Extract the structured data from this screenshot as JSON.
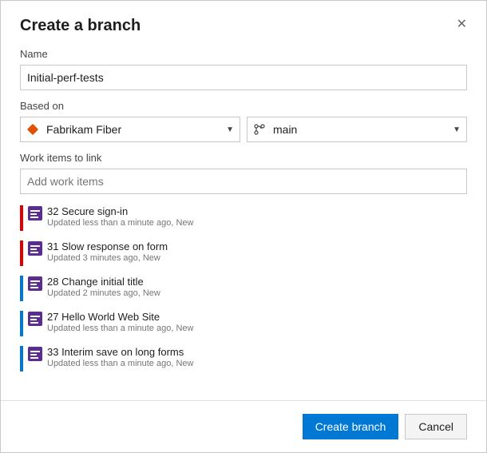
{
  "dialog": {
    "title": "Create a branch",
    "close_label": "✕"
  },
  "name_field": {
    "label": "Name",
    "value": "Initial-perf-tests",
    "placeholder": ""
  },
  "based_on": {
    "label": "Based on",
    "repo_options": [
      "Fabrikam Fiber"
    ],
    "repo_selected": "Fabrikam Fiber",
    "branch_options": [
      "main"
    ],
    "branch_selected": "main"
  },
  "work_items": {
    "label": "Work items to link",
    "placeholder": "Add work items",
    "items": [
      {
        "id": "32",
        "title": "Secure sign-in",
        "meta": "Updated less than a minute ago, New",
        "color": "#e00000",
        "icon_bg": "#5c2d91"
      },
      {
        "id": "31",
        "title": "Slow response on form",
        "meta": "Updated 3 minutes ago, New",
        "color": "#e00000",
        "icon_bg": "#5c2d91"
      },
      {
        "id": "28",
        "title": "Change initial title",
        "meta": "Updated 2 minutes ago, New",
        "color": "#0078d4",
        "icon_bg": "#5c2d91"
      },
      {
        "id": "27",
        "title": "Hello World Web Site",
        "meta": "Updated less than a minute ago, New",
        "color": "#0078d4",
        "icon_bg": "#5c2d91"
      },
      {
        "id": "33",
        "title": "Interim save on long forms",
        "meta": "Updated less than a minute ago, New",
        "color": "#0078d4",
        "icon_bg": "#5c2d91"
      }
    ]
  },
  "footer": {
    "create_label": "Create branch",
    "cancel_label": "Cancel"
  }
}
